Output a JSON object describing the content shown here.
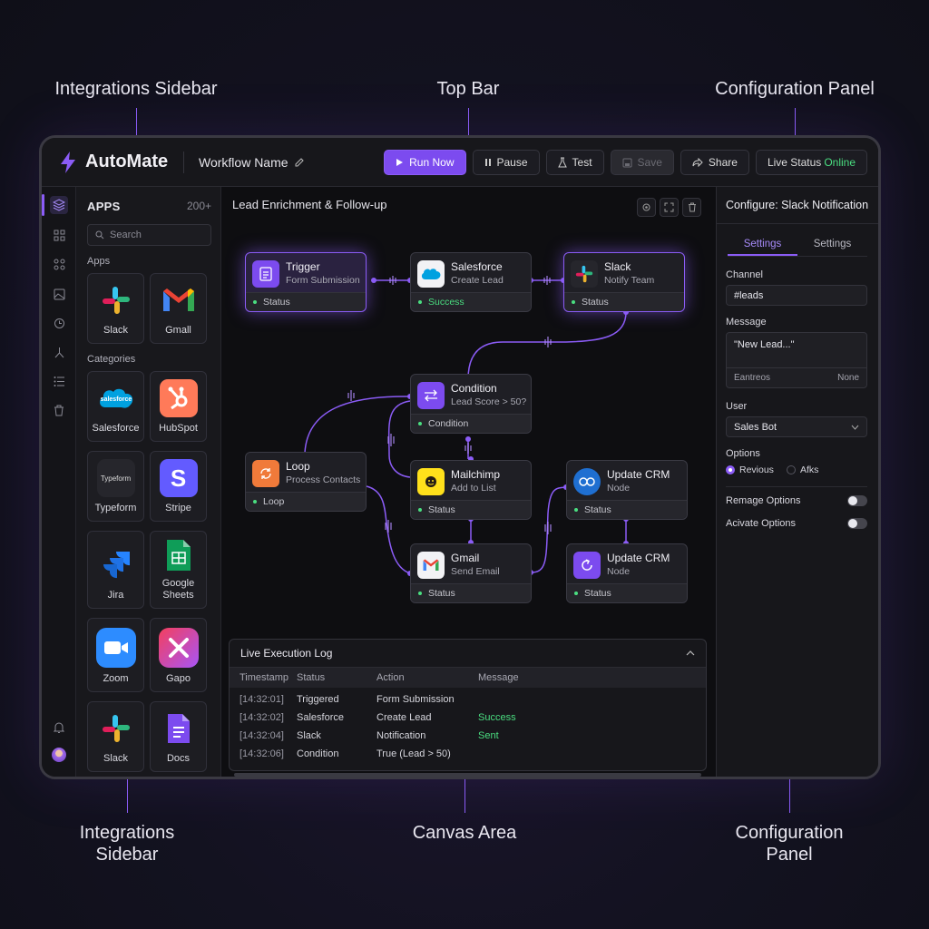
{
  "annotations": {
    "top_left": "Integrations Sidebar",
    "top_center": "Top Bar",
    "top_right": "Configuration Panel",
    "bottom_left": "Integrations Sidebar",
    "bottom_center": "Canvas Area",
    "bottom_right": "Configuration Panel"
  },
  "topbar": {
    "app_name": "AutoMate",
    "workflow_name": "Workflow Name",
    "run_label": "Run Now",
    "pause_label": "Pause",
    "test_label": "Test",
    "save_label": "Save",
    "share_label": "Share",
    "status_label": "Live Status",
    "status_value": "Online"
  },
  "sidebar": {
    "title": "APPS",
    "count": "200+",
    "search_placeholder": "Search",
    "apps_heading": "Apps",
    "categories_heading": "Categories",
    "apps": [
      {
        "label": "Slack",
        "icon": "slack-icon"
      },
      {
        "label": "Gmall",
        "icon": "gmail-icon"
      }
    ],
    "categories": [
      {
        "label": "Salesforce",
        "icon": "salesforce-icon",
        "icon_text": "salesforce"
      },
      {
        "label": "HubSpot",
        "icon": "hubspot-icon"
      },
      {
        "label": "Typeform",
        "icon": "typeform-icon",
        "icon_text": "Typeform"
      },
      {
        "label": "Stripe",
        "icon": "stripe-icon",
        "icon_text": "S"
      },
      {
        "label": "Jira",
        "icon": "jira-icon"
      },
      {
        "label": "Google Sheets",
        "icon": "google-sheets-icon"
      },
      {
        "label": "Zoom",
        "icon": "zoom-icon"
      },
      {
        "label": "Gapo",
        "icon": "gapo-icon"
      },
      {
        "label": "Slack",
        "icon": "slack-icon"
      },
      {
        "label": "Docs",
        "icon": "docs-icon"
      }
    ]
  },
  "canvas": {
    "title": "Lead Enrichment & Follow-up",
    "nodes": {
      "trigger": {
        "title": "Trigger",
        "subtitle": "Form Submission",
        "footer": "Status"
      },
      "salesforce": {
        "title": "Salesforce",
        "subtitle": "Create Lead",
        "footer": "Success"
      },
      "slack": {
        "title": "Slack",
        "subtitle": "Notify Team",
        "footer": "Status"
      },
      "condition": {
        "title": "Condition",
        "subtitle": "Lead Score > 50?",
        "footer": "Condition"
      },
      "loop": {
        "title": "Loop",
        "subtitle": "Process Contacts",
        "footer": "Loop"
      },
      "mailchimp": {
        "title": "Mailchimp",
        "subtitle": "Add to List",
        "footer": "Status"
      },
      "update_crm_1": {
        "title": "Update CRM",
        "subtitle": "Node",
        "footer": "Status"
      },
      "gmail": {
        "title": "Gmail",
        "subtitle": "Send Email",
        "footer": "Status"
      },
      "update_crm_2": {
        "title": "Update CRM",
        "subtitle": "Node",
        "footer": "Status"
      }
    }
  },
  "log": {
    "title": "Live Execution Log",
    "columns": [
      "Timestamp",
      "Status",
      "Action",
      "Message"
    ],
    "rows": [
      {
        "timestamp": "[14:32:01]",
        "status": "Triggered",
        "action": "Form Submission",
        "message": ""
      },
      {
        "timestamp": "[14:32:02]",
        "status": "Salesforce",
        "action": "Create Lead",
        "message": "Success"
      },
      {
        "timestamp": "[14:32:04]",
        "status": "Slack",
        "action": "Notification",
        "message": "Sent"
      },
      {
        "timestamp": "[14:32:06]",
        "status": "Condition",
        "action": "True (Lead > 50)",
        "message": ""
      }
    ]
  },
  "config": {
    "title": "Configure: Slack Notification",
    "tabs": [
      "Settings",
      "Settings"
    ],
    "channel_label": "Channel",
    "channel_value": "#leads",
    "message_label": "Message",
    "message_value": "\"New Lead...\"",
    "message_footer_left": "Eantreos",
    "message_footer_right": "None",
    "user_label": "User",
    "user_value": "Sales Bot",
    "options_label": "Options",
    "radio_1": "Revious",
    "radio_2": "Afks",
    "toggle_1": "Remage Options",
    "toggle_2": "Acivate Options"
  },
  "colors": {
    "accent": "#8b5cf6",
    "success": "#4ade80"
  }
}
